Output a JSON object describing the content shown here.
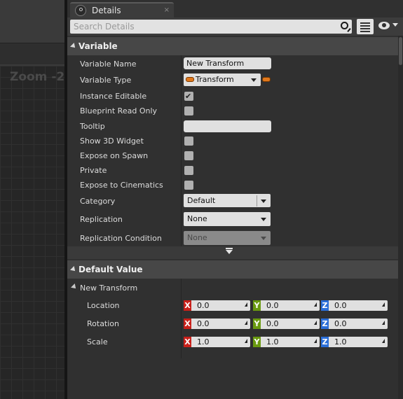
{
  "graph": {
    "zoom_label": "Zoom -2"
  },
  "details": {
    "tab_title": "Details",
    "tab_close": "×",
    "search_placeholder": "Search Details"
  },
  "variable_section": {
    "title": "Variable",
    "fields": {
      "variable_name": {
        "label": "Variable Name",
        "value": "New Transform"
      },
      "variable_type": {
        "label": "Variable Type",
        "value": "Transform",
        "pill_color": "#e0781c"
      },
      "instance_editable": {
        "label": "Instance Editable",
        "checked": true,
        "mark": "✔"
      },
      "blueprint_read_only": {
        "label": "Blueprint Read Only",
        "checked": false
      },
      "tooltip": {
        "label": "Tooltip",
        "value": ""
      },
      "show_3d_widget": {
        "label": "Show 3D Widget",
        "checked": false
      },
      "expose_on_spawn": {
        "label": "Expose on Spawn",
        "checked": false
      },
      "private": {
        "label": "Private",
        "checked": false
      },
      "expose_to_cinematics": {
        "label": "Expose to Cinematics",
        "checked": false
      },
      "category": {
        "label": "Category",
        "value": "Default"
      },
      "replication": {
        "label": "Replication",
        "value": "None"
      },
      "replication_condition": {
        "label": "Replication Condition",
        "value": "None"
      }
    }
  },
  "default_value_section": {
    "title": "Default Value",
    "group_label": "New Transform",
    "axis_letters": {
      "x": "X",
      "y": "Y",
      "z": "Z"
    },
    "axis_colors": {
      "x": "#c8201a",
      "y": "#6a9a10",
      "z": "#2a6ed8"
    },
    "rows": {
      "location": {
        "label": "Location",
        "x": "0.0",
        "y": "0.0",
        "z": "0.0"
      },
      "rotation": {
        "label": "Rotation",
        "x": "0.0",
        "y": "0.0",
        "z": "0.0"
      },
      "scale": {
        "label": "Scale",
        "x": "1.0",
        "y": "1.0",
        "z": "1.0"
      }
    }
  }
}
